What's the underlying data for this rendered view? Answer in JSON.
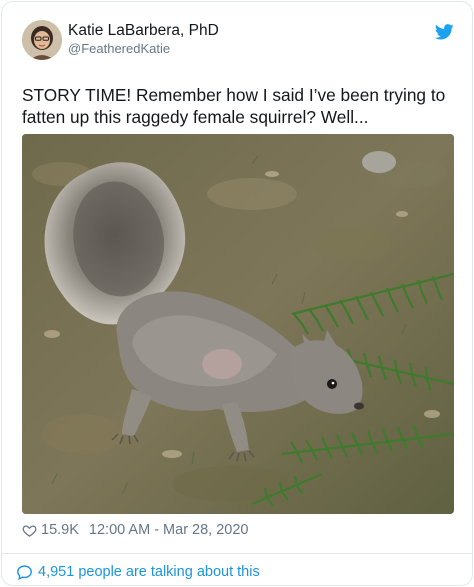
{
  "author": {
    "name": "Katie LaBarbera, PhD",
    "handle": "@FeatheredKatie",
    "avatar_icon": "profile-photo"
  },
  "brand": {
    "icon": "twitter-bird-icon",
    "color": "#1da1f2"
  },
  "tweet": {
    "text": "STORY TIME! Remember how I said I’ve been trying to fatten up this raggedy female squirrel? Well...",
    "image_icon": "squirrel-photo"
  },
  "meta": {
    "like_icon": "heart-icon",
    "likes": "15.9K",
    "timestamp": "12:00 AM - Mar 28, 2020"
  },
  "footer": {
    "icon": "speech-bubble-icon",
    "talking_text": "4,951 people are talking about this",
    "link_color": "#1b95e0"
  }
}
